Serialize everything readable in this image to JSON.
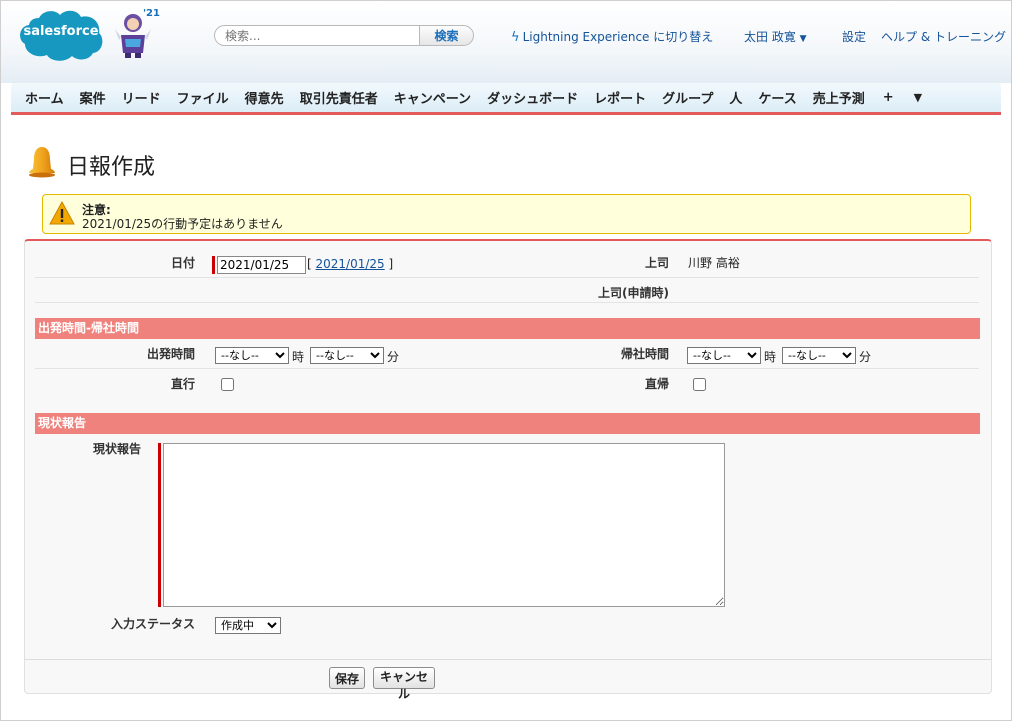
{
  "header": {
    "logo_text": "salesforce",
    "release_badge": "'21",
    "search_placeholder": "検索...",
    "search_button": "検索",
    "lightning_link": "Lightning Experience に切り替え",
    "user_name": "太田 政寛",
    "settings_link": "設定",
    "help_link": "ヘルプ & トレーニング"
  },
  "tabs": [
    {
      "label": "ホーム"
    },
    {
      "label": "案件"
    },
    {
      "label": "リード"
    },
    {
      "label": "ファイル"
    },
    {
      "label": "得意先"
    },
    {
      "label": "取引先責任者"
    },
    {
      "label": "キャンペーン"
    },
    {
      "label": "ダッシュボード"
    },
    {
      "label": "レポート"
    },
    {
      "label": "グループ"
    },
    {
      "label": "人"
    },
    {
      "label": "ケース"
    },
    {
      "label": "売上予測"
    }
  ],
  "tab_more": {
    "plus": "+",
    "dropdown": "▼"
  },
  "page": {
    "title": "日報作成",
    "warning_title": "注意:",
    "warning_message": "2021/01/25の行動予定はありません"
  },
  "form": {
    "date_label": "日付",
    "date_value": "2021/01/25",
    "date_link_open": "[",
    "date_link": "2021/01/25",
    "date_link_close": "]",
    "boss_label": "上司",
    "boss_value": "川野 高裕",
    "boss_at_apply_label": "上司(申請時)",
    "section_time": "出発時間-帰社時間",
    "depart_label": "出発時間",
    "return_label": "帰社時間",
    "none_option": "--なし--",
    "hour_unit": "時",
    "minute_unit": "分",
    "direct_go_label": "直行",
    "direct_return_label": "直帰",
    "section_report": "現状報告",
    "report_label": "現状報告",
    "report_value": "",
    "status_label": "入力ステータス",
    "status_value": "作成中",
    "save_button": "保存",
    "cancel_button": "キャンセル"
  },
  "colors": {
    "accent_red": "#e35a5a",
    "section_bg": "#ef827d",
    "link_blue": "#15539a",
    "logo_blue": "#1798c1"
  }
}
